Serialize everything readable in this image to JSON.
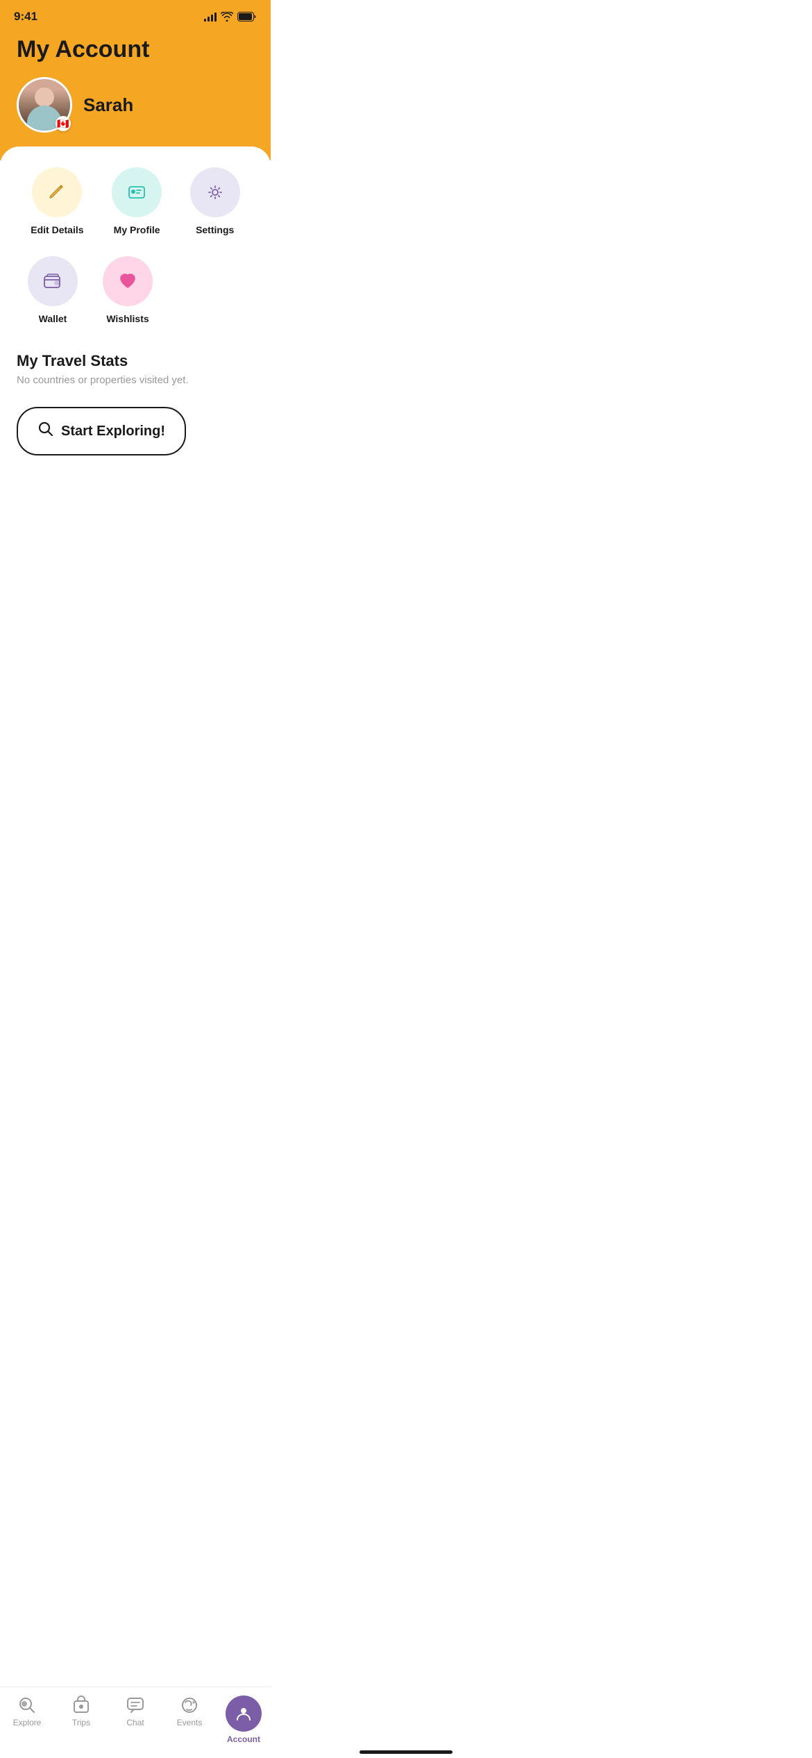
{
  "statusBar": {
    "time": "9:41"
  },
  "header": {
    "title": "My Account",
    "userName": "Sarah",
    "flagEmoji": "🇨🇦"
  },
  "quickActions": {
    "row1": [
      {
        "id": "edit-details",
        "label": "Edit Details",
        "circleClass": "circle-edit"
      },
      {
        "id": "my-profile",
        "label": "My Profile",
        "circleClass": "circle-profile"
      },
      {
        "id": "settings",
        "label": "Settings",
        "circleClass": "circle-settings"
      }
    ],
    "row2": [
      {
        "id": "wallet",
        "label": "Wallet",
        "circleClass": "circle-wallet"
      },
      {
        "id": "wishlists",
        "label": "Wishlists",
        "circleClass": "circle-wishlists"
      }
    ]
  },
  "travelStats": {
    "title": "My Travel Stats",
    "subtitle": "No countries or properties visited yet."
  },
  "exploreButton": {
    "label": "Start Exploring!"
  },
  "bottomNav": {
    "items": [
      {
        "id": "explore",
        "label": "Explore",
        "active": false
      },
      {
        "id": "trips",
        "label": "Trips",
        "active": false
      },
      {
        "id": "chat",
        "label": "Chat",
        "active": false
      },
      {
        "id": "events",
        "label": "Events",
        "active": false
      },
      {
        "id": "account",
        "label": "Account",
        "active": true
      }
    ]
  }
}
